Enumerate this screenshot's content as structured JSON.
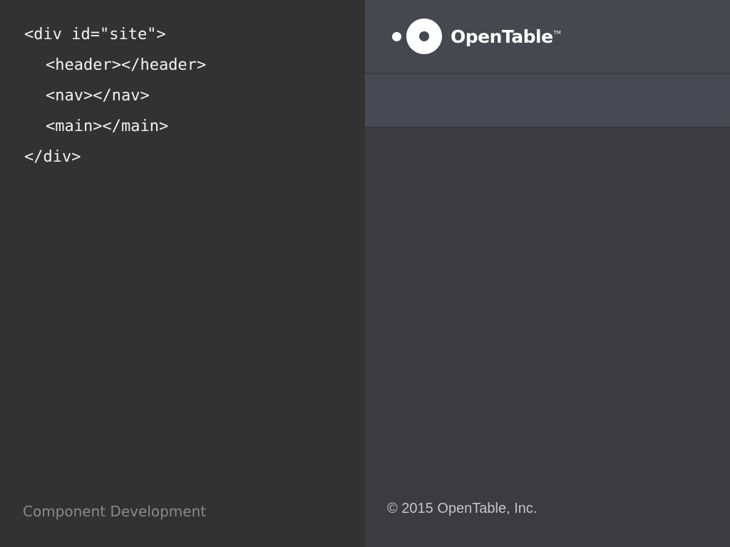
{
  "code": {
    "lines": [
      "<div id=\"site\">",
      "<header></header>",
      "<nav></nav>",
      "<main></main>",
      "</div>"
    ]
  },
  "footer_left": {
    "label": "Component Development"
  },
  "preview": {
    "logo": {
      "icon": "opentable-logo-icon",
      "text": "OpenTable",
      "tm": "TM"
    },
    "copyright": "© 2015 OpenTable, Inc."
  },
  "colors": {
    "code_bg": "#323232",
    "header_bg": "#46484f",
    "nav_bg": "#474a52",
    "main_bg": "#3b3b40",
    "code_text": "#f2f2f2",
    "muted_text": "#8a8a8a"
  }
}
